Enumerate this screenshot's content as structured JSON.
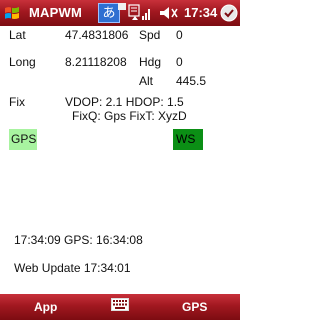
{
  "statusbar": {
    "title": "MAPWM",
    "ime_label": "あ",
    "clock": "17:34"
  },
  "readout": {
    "lat_label": "Lat",
    "lat_value": "47.4831806",
    "long_label": "Long",
    "long_value": "8.21118208",
    "spd_label": "Spd",
    "spd_value": "0",
    "hdg_label": "Hdg",
    "hdg_value": "0",
    "alt_label": "Alt",
    "alt_value": "445.5",
    "fix_label": "Fix",
    "dop_text": "VDOP: 2.1 HDOP: 1.5",
    "fixq_text": "FixQ: Gps FixT: XyzD"
  },
  "indicators": {
    "gps_label": "GPS",
    "gps_color": "#a8f3a0",
    "ws_label": "WS",
    "ws_color": "#0b8f15"
  },
  "times": {
    "gps_time_text": "17:34:09 GPS:  16:34:08",
    "web_update_text": "Web Update 17:34:01"
  },
  "menubar": {
    "left_softkey": "App",
    "right_softkey": "GPS",
    "center_icon": "keyboard-icon"
  },
  "colors": {
    "bar_red": "#a11820"
  }
}
